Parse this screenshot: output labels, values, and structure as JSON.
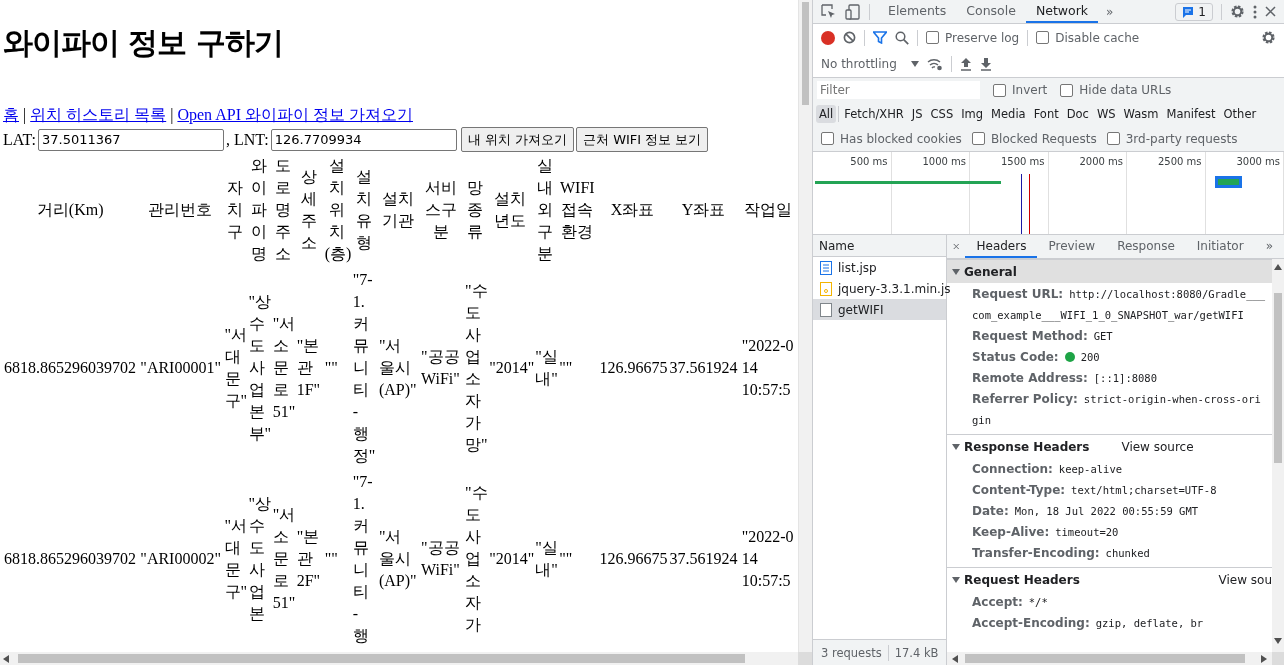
{
  "page": {
    "title": "와이파이 정보 구하기",
    "nav": [
      {
        "kind": "link",
        "text": "홈"
      },
      {
        "kind": "separator",
        "text": "|"
      },
      {
        "kind": "link",
        "text": "위치 히스토리 목록"
      },
      {
        "kind": "separator",
        "text": "|"
      },
      {
        "kind": "link",
        "text": "Open API 와이파이 정보 가져오기"
      }
    ],
    "form": {
      "lat_label": "LAT:",
      "lat_value": "37.5011367",
      "lnt_label": ", LNT:",
      "lnt_value": "126.7709934",
      "buttons": [
        "내 위치 가져오기",
        "근처 WIFI 정보 보기"
      ]
    },
    "table": {
      "columns": [
        "거리(Km)",
        "관리번호",
        "자치구",
        "와이파이명",
        "도로명주소",
        "상세주소",
        "설치위치(층)",
        "설치유형",
        "설치기관",
        "서비스구분",
        "망종류",
        "설치년도",
        "실내외구분",
        "WIFI접속환경",
        "X좌표",
        "Y좌표",
        "작업일"
      ],
      "rows": [
        [
          "6818.865296039702",
          "\"ARI00001\"",
          "\"서대문구\"",
          "\"상수도사업본부\"",
          "\"서소문로 51\"",
          "\"본관 1F\"",
          "\"\"",
          "\"7-1. 커뮤니티 - 행정\"",
          "\"서울시(AP)\"",
          "\"공공WiFi\"",
          "\"수도사업소자가망\"",
          "\"2014\"",
          "\"실내\"",
          "\"\"",
          "126.96675",
          "37.561924",
          "\"2022-0\n14\n10:57:5"
        ],
        [
          "6818.865296039702",
          "\"ARI00002\"",
          "\"서대문구\"",
          "\"상수도사업본",
          "\"서소문로 51\"",
          "\"본관 2F\"",
          "\"\"",
          "\"7-1. 커뮤니티 - 행",
          "\"서울시(AP)\"",
          "\"공공WiFi\"",
          "\"수도사업소자가",
          "\"2014\"",
          "\"실내\"",
          "\"\"",
          "126.96675",
          "37.561924",
          "\"2022-0\n14\n10:57:5"
        ]
      ]
    }
  },
  "devtools": {
    "tabs": [
      {
        "label": "Elements",
        "selected": false
      },
      {
        "label": "Console",
        "selected": false
      },
      {
        "label": "Network",
        "selected": true
      }
    ],
    "more": "»",
    "issues_count": "1",
    "preserve_log": {
      "label": "Preserve log",
      "checked": false
    },
    "disable_cache": {
      "label": "Disable cache",
      "checked": false
    },
    "throttling": "No throttling",
    "filter": {
      "placeholder": "Filter"
    },
    "invert": {
      "label": "Invert",
      "checked": false
    },
    "hide_data_urls": {
      "label": "Hide data URLs",
      "checked": false
    },
    "type_filters": [
      {
        "label": "All",
        "selected": true
      },
      {
        "label": "Fetch/XHR",
        "selected": false
      },
      {
        "label": "JS",
        "selected": false
      },
      {
        "label": "CSS",
        "selected": false
      },
      {
        "label": "Img",
        "selected": false
      },
      {
        "label": "Media",
        "selected": false
      },
      {
        "label": "Font",
        "selected": false
      },
      {
        "label": "Doc",
        "selected": false
      },
      {
        "label": "WS",
        "selected": false
      },
      {
        "label": "Wasm",
        "selected": false
      },
      {
        "label": "Manifest",
        "selected": false
      },
      {
        "label": "Other",
        "selected": false
      }
    ],
    "blocked_filters": [
      {
        "label": "Has blocked cookies",
        "checked": false
      },
      {
        "label": "Blocked Requests",
        "checked": false
      },
      {
        "label": "3rd-party requests",
        "checked": false
      }
    ],
    "timeline_ticks": [
      "500 ms",
      "1000 ms",
      "1500 ms",
      "2000 ms",
      "2500 ms",
      "3000 ms"
    ],
    "name_header": "Name",
    "requests": [
      {
        "name": "list.jsp",
        "kind": "document",
        "selected": false
      },
      {
        "name": "jquery-3.3.1.min.js",
        "kind": "script",
        "selected": false
      },
      {
        "name": "getWIFI",
        "kind": "fetch",
        "selected": true
      }
    ],
    "summary": [
      "3 requests",
      "17.4 kB"
    ],
    "detail_tabs": [
      {
        "label": "Headers",
        "selected": true
      },
      {
        "label": "Preview",
        "selected": false
      },
      {
        "label": "Response",
        "selected": false
      },
      {
        "label": "Initiator",
        "selected": false
      }
    ],
    "sections": [
      {
        "title": "General",
        "expanded": true,
        "highlighted": true,
        "rows": [
          {
            "label": "Request URL:",
            "value": "http://localhost:8080/Gradle___com_example___WIFI_1_0_SNAPSHOT_war/getWIFI"
          },
          {
            "label": "Request Method:",
            "value": "GET"
          },
          {
            "label": "Status Code:",
            "value": "200",
            "color": "#1ea446"
          },
          {
            "label": "Remote Address:",
            "value": "[::1]:8080"
          },
          {
            "label": "Referrer Policy:",
            "value": "strict-origin-when-cross-origin"
          }
        ]
      },
      {
        "title": "Response Headers",
        "expanded": true,
        "highlighted": false,
        "link": "View source",
        "rows": [
          {
            "label": "Connection:",
            "value": "keep-alive"
          },
          {
            "label": "Content-Type:",
            "value": "text/html;charset=UTF-8"
          },
          {
            "label": "Date:",
            "value": "Mon, 18 Jul 2022 00:55:59 GMT"
          },
          {
            "label": "Keep-Alive:",
            "value": "timeout=20"
          },
          {
            "label": "Transfer-Encoding:",
            "value": "chunked"
          }
        ]
      },
      {
        "title": "Request Headers",
        "expanded": true,
        "highlighted": false,
        "link": "View sou",
        "link_right": true,
        "rows": [
          {
            "label": "Accept:",
            "value": "*/*"
          },
          {
            "label": "Accept-Encoding:",
            "value": "gzip, deflate, br"
          }
        ]
      }
    ]
  }
}
